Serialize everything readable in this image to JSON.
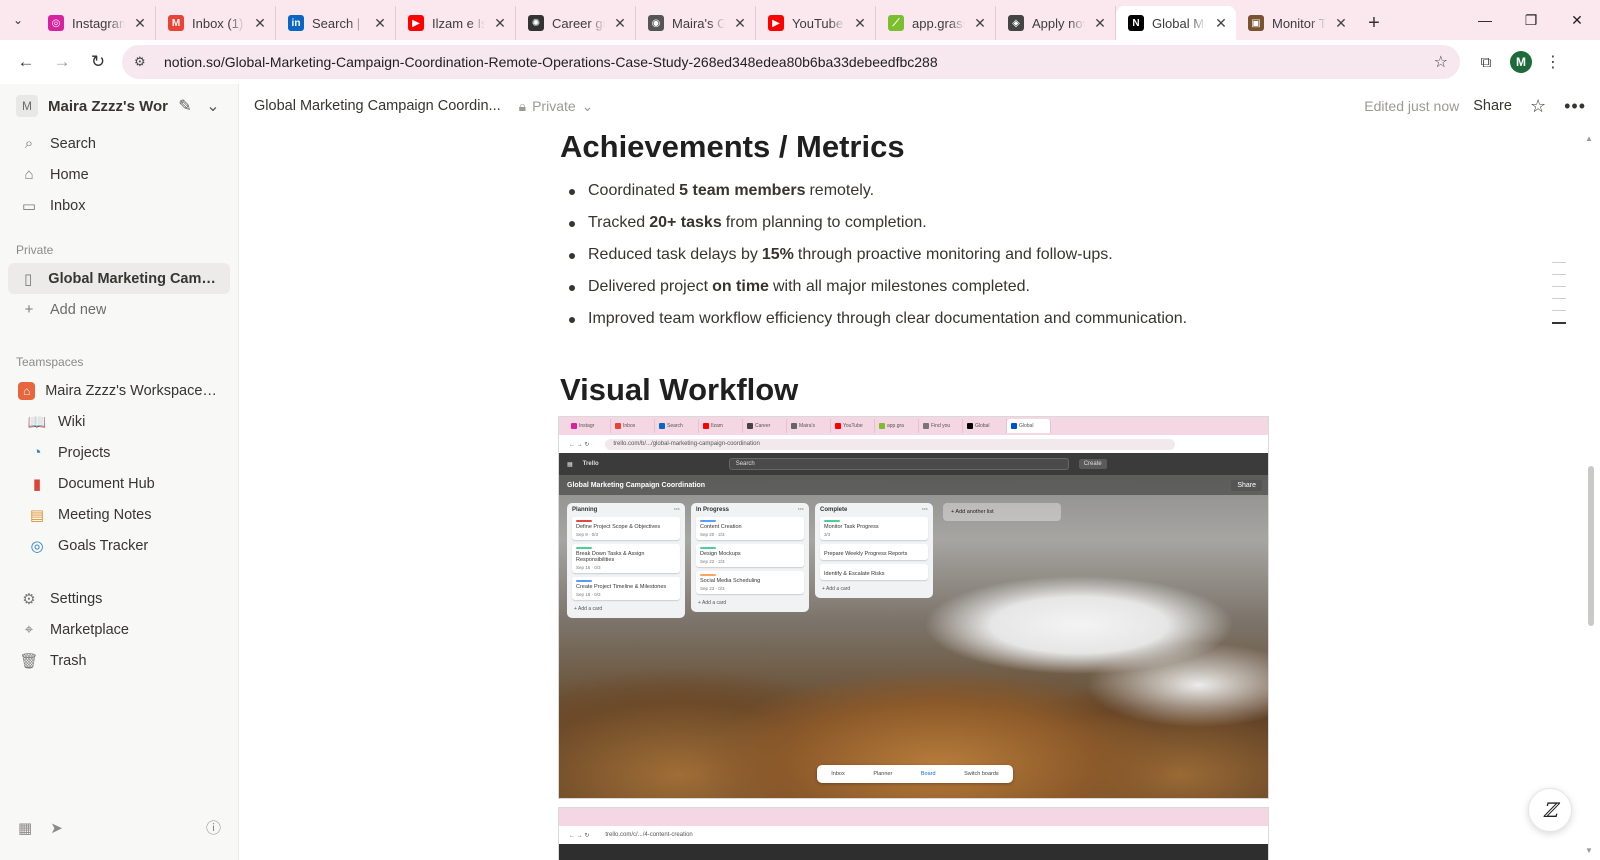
{
  "browser": {
    "tabs": [
      {
        "title": "Instagram",
        "favicon_color": "#d6249f",
        "glyph": "◎"
      },
      {
        "title": "Inbox (1)",
        "favicon_color": "#ea4335",
        "glyph": "M"
      },
      {
        "title": "Search | LinkedIn",
        "favicon_color": "#0a66c2",
        "glyph": "in"
      },
      {
        "title": "Ilzam e Ishq",
        "favicon_color": "#ff0000",
        "glyph": "▶"
      },
      {
        "title": "Career guide",
        "favicon_color": "#333333",
        "glyph": "✺"
      },
      {
        "title": "Maira's Github",
        "favicon_color": "#555555",
        "glyph": "◉"
      },
      {
        "title": "YouTube",
        "favicon_color": "#ff0000",
        "glyph": "▶"
      },
      {
        "title": "app.grass",
        "favicon_color": "#7bbf2e",
        "glyph": "⟋"
      },
      {
        "title": "Apply now",
        "favicon_color": "#444444",
        "glyph": "◈"
      },
      {
        "title": "Global Marketing",
        "favicon_color": "#000000",
        "glyph": "N",
        "active": true
      },
      {
        "title": "Monitor Task",
        "favicon_color": "#7a5230",
        "glyph": "▣"
      }
    ],
    "url": "notion.so/Global-Marketing-Campaign-Coordination-Remote-Operations-Case-Study-268ed348edea80b6ba33debeedfbc288",
    "profile_initial": "M"
  },
  "sidebar": {
    "workspace_initial": "M",
    "workspace_name": "Maira Zzzz's Wor...",
    "nav": [
      {
        "label": "Search",
        "icon": "search-icon"
      },
      {
        "label": "Home",
        "icon": "home-icon"
      },
      {
        "label": "Inbox",
        "icon": "inbox-icon"
      }
    ],
    "private_heading": "Private",
    "private_pages": [
      {
        "label": "Global Marketing Campai...",
        "icon": "page-icon"
      }
    ],
    "add_new": "Add new",
    "teamspaces_heading": "Teamspaces",
    "teamspace": "Maira Zzzz's Workspace HQ",
    "team_pages": [
      {
        "label": "Wiki",
        "icon": "book-icon"
      },
      {
        "label": "Projects",
        "icon": "projects-icon"
      },
      {
        "label": "Document Hub",
        "icon": "document-icon"
      },
      {
        "label": "Meeting Notes",
        "icon": "calendar-icon"
      },
      {
        "label": "Goals Tracker",
        "icon": "goals-icon"
      }
    ],
    "bottom": [
      {
        "label": "Settings",
        "icon": "gear-icon"
      },
      {
        "label": "Marketplace",
        "icon": "marketplace-icon"
      },
      {
        "label": "Trash",
        "icon": "trash-icon"
      }
    ]
  },
  "header": {
    "breadcrumb": "Global Marketing Campaign Coordin...",
    "privacy": "Private",
    "edited": "Edited just now",
    "share": "Share"
  },
  "content": {
    "achievements_heading": "Achievements / Metrics",
    "metrics": [
      {
        "pre": "Coordinated",
        "bold": "5 team members",
        "post": "remotely."
      },
      {
        "pre": "Tracked",
        "bold": "20+ tasks",
        "post": "from planning to completion."
      },
      {
        "pre": "Reduced task delays by",
        "bold": "15%",
        "post": "through proactive monitoring and follow-ups."
      },
      {
        "pre": "Delivered project",
        "bold": "on time",
        "post": "with all major milestones completed."
      },
      {
        "pre": "Improved team workflow efficiency through clear documentation and communication.",
        "bold": "",
        "post": ""
      }
    ],
    "workflow_heading": "Visual Workflow"
  },
  "embedded_board": {
    "url": "trello.com/b/.../global-marketing-campaign-coordination",
    "app": "Trello",
    "search": "Search",
    "create": "Create",
    "board_title": "Global Marketing Campaign Coordination",
    "share": "Share",
    "lists": [
      {
        "name": "Planning",
        "cards": [
          {
            "title": "Define Project Scope & Objectives",
            "meta": "Sep 9 · 0/3",
            "color": "#e2483d"
          },
          {
            "title": "Break Down Tasks & Assign Responsibilities",
            "meta": "Sep 16 · 0/3",
            "color": "#4bce97"
          },
          {
            "title": "Create Project Timeline & Milestones",
            "meta": "Sep 18 · 0/3",
            "color": "#579dff"
          }
        ],
        "add": "+ Add a card"
      },
      {
        "name": "In Progress",
        "cards": [
          {
            "title": "Content Creation",
            "meta": "Sep 20 · 2/3",
            "color": "#579dff"
          },
          {
            "title": "Design Mockups",
            "meta": "Sep 22 · 2/3",
            "color": "#4bce97"
          },
          {
            "title": "Social Media Scheduling",
            "meta": "Sep 23 · 0/3",
            "color": "#fea362"
          }
        ],
        "add": "+ Add a card"
      },
      {
        "name": "Complete",
        "cards": [
          {
            "title": "Monitor Task Progress",
            "meta": "3/3",
            "color": "#4bce97"
          },
          {
            "title": "Prepare Weekly Progress Reports",
            "meta": "",
            "color": "#ffffff"
          },
          {
            "title": "Identify & Escalate Risks",
            "meta": "",
            "color": "#ffffff"
          }
        ],
        "add": "+ Add a card"
      }
    ],
    "add_list": "+ Add another list",
    "bottom_nav": [
      "Inbox",
      "Planner",
      "Board",
      "Switch boards"
    ],
    "second_url": "trello.com/c/.../4-content-creation"
  }
}
